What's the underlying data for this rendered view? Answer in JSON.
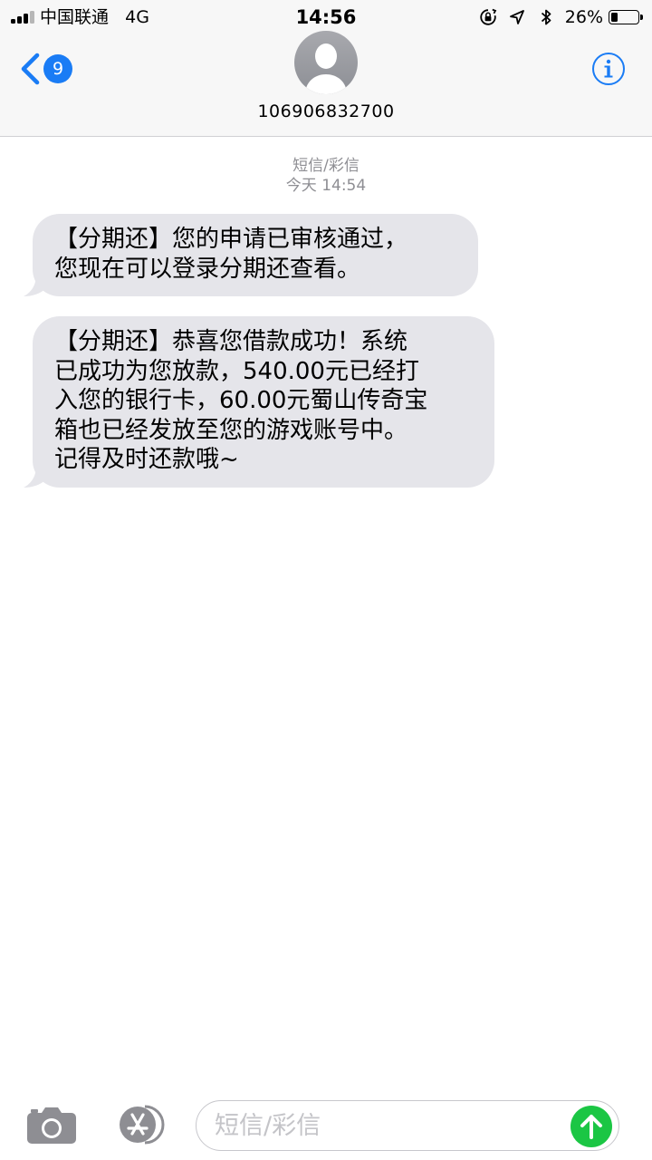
{
  "status_bar": {
    "carrier": "中国联通",
    "network": "4G",
    "time": "14:56",
    "battery_percent": "26%",
    "battery_level": 0.26
  },
  "header": {
    "unread_count": "9",
    "contact_name": "106906832700"
  },
  "conversation": {
    "message_type": "短信/彩信",
    "timestamp": "今天 14:54",
    "messages": [
      {
        "text": "【分期还】您的申请已审核通过，\n您现在可以登录分期还查看。"
      },
      {
        "text": "【分期还】恭喜您借款成功！系统\n已成功为您放款，540.00元已经打\n入您的银行卡，60.00元蜀山传奇宝\n箱也已经发放至您的游戏账号中。\n记得及时还款哦~"
      }
    ]
  },
  "input_bar": {
    "placeholder": "短信/彩信"
  },
  "colors": {
    "accent": "#1a7cf5",
    "bubble": "#e5e5ea",
    "send": "#1bc644",
    "meta_text": "#8e8e93"
  },
  "icons": {
    "back": "chevron-left-icon",
    "info": "info-icon",
    "camera": "camera-icon",
    "apps": "app-store-icon",
    "send": "arrow-up-icon"
  }
}
